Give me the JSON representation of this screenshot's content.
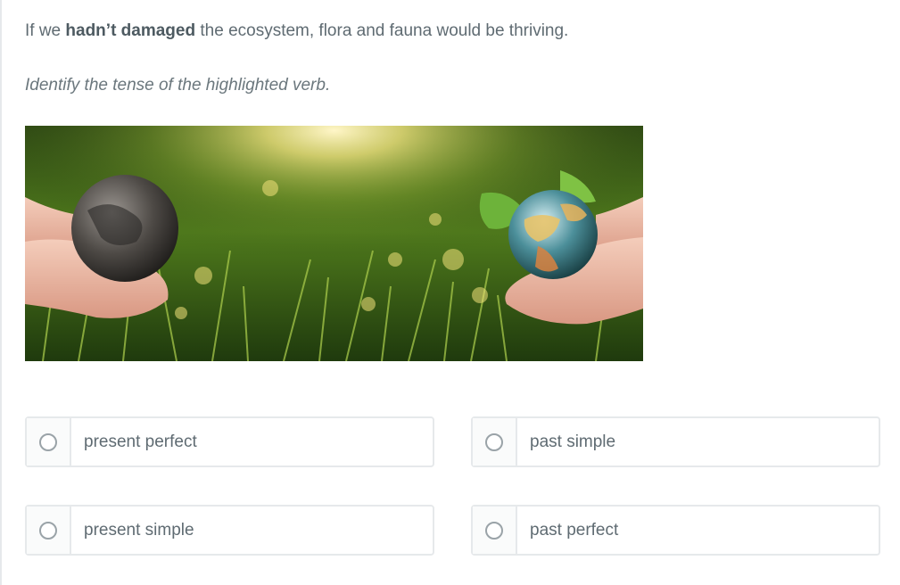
{
  "question": {
    "sentence_before": "If we ",
    "highlighted_verb": "hadn’t damaged",
    "sentence_after": " the ecosystem, flora and fauna would be thriving.",
    "instruction": "Identify the tense of the highlighted verb."
  },
  "image": {
    "description_icon": "hands-holding-globes-in-grass-image"
  },
  "options": [
    {
      "label": "present perfect",
      "selected": false
    },
    {
      "label": "past simple",
      "selected": false
    },
    {
      "label": "present simple",
      "selected": false
    },
    {
      "label": "past perfect",
      "selected": false
    }
  ],
  "colors": {
    "text": "#5f6b72",
    "border": "#e6e9eb",
    "radio_border": "#9aa3a8"
  }
}
